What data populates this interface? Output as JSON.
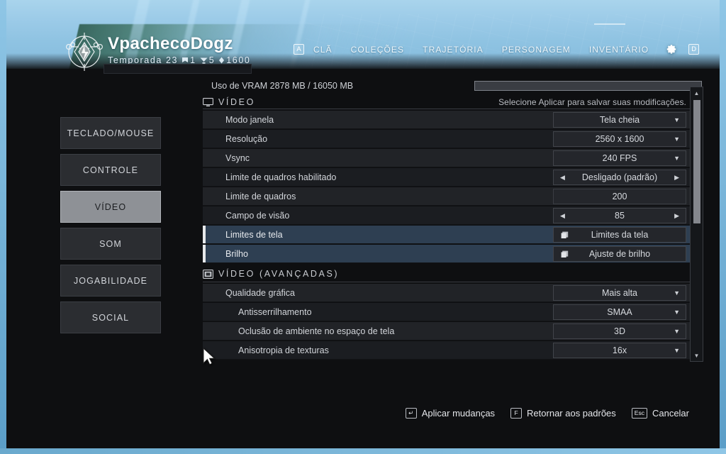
{
  "header": {
    "player_name": "VpachecoDogz",
    "season_label": "Temporada 23",
    "stats": [
      {
        "icon": "banner-icon",
        "value": "1"
      },
      {
        "icon": "crest-icon",
        "value": "5"
      },
      {
        "icon": "power-icon",
        "value": "1600"
      }
    ],
    "nav": {
      "left_key": "A",
      "right_key": "D",
      "items": [
        {
          "label": "CLÃ",
          "name": "nav-item-cla"
        },
        {
          "label": "COLEÇÕES",
          "name": "nav-item-colecoes"
        },
        {
          "label": "TRAJETÓRIA",
          "name": "nav-item-trajetoria"
        },
        {
          "label": "PERSONAGEM",
          "name": "nav-item-personagem"
        },
        {
          "label": "INVENTÁRIO",
          "name": "nav-item-inventario"
        }
      ],
      "settings_icon": "gear-icon"
    }
  },
  "sidebar": {
    "items": [
      {
        "label": "TECLADO/MOUSE",
        "name": "sidebar-item-teclado-mouse",
        "active": false
      },
      {
        "label": "CONTROLE",
        "name": "sidebar-item-controle",
        "active": false
      },
      {
        "label": "VÍDEO",
        "name": "sidebar-item-video",
        "active": true
      },
      {
        "label": "SOM",
        "name": "sidebar-item-som",
        "active": false
      },
      {
        "label": "JOGABILIDADE",
        "name": "sidebar-item-jogabilidade",
        "active": false
      },
      {
        "label": "SOCIAL",
        "name": "sidebar-item-social",
        "active": false
      }
    ]
  },
  "vram": {
    "label": "Uso de VRAM 2878 MB / 16050 MB",
    "used_mb": 2878,
    "total_mb": 16050,
    "percent": 17.9
  },
  "sections": {
    "video": {
      "title": "VÍDEO",
      "icon": "monitor-icon",
      "hint": "Selecione Aplicar para salvar suas modificações.",
      "rows": [
        {
          "label": "Modo janela",
          "value": "Tela cheia",
          "control": "dropdown",
          "highlighted": false
        },
        {
          "label": "Resolução",
          "value": "2560 x 1600",
          "control": "dropdown",
          "highlighted": false
        },
        {
          "label": "Vsync",
          "value": "240 FPS",
          "control": "dropdown",
          "highlighted": false
        },
        {
          "label": "Limite de quadros habilitado",
          "value": "Desligado (padrão)",
          "control": "stepper",
          "highlighted": false
        },
        {
          "label": "Limite de quadros",
          "value": "200",
          "control": "value",
          "highlighted": false
        },
        {
          "label": "Campo de visão",
          "value": "85",
          "control": "stepper",
          "highlighted": false
        },
        {
          "label": "Limites de tela",
          "value": "Limites da tela",
          "control": "window",
          "highlighted": true
        },
        {
          "label": "Brilho",
          "value": "Ajuste de brilho",
          "control": "window",
          "highlighted": true
        }
      ]
    },
    "video_advanced": {
      "title": "VÍDEO (AVANÇADAS)",
      "icon": "sliders-icon",
      "rows": [
        {
          "label": "Qualidade gráfica",
          "value": "Mais alta",
          "control": "dropdown",
          "indent": false
        },
        {
          "label": "Antisserrilhamento",
          "value": "SMAA",
          "control": "dropdown",
          "indent": true
        },
        {
          "label": "Oclusão de ambiente no espaço de tela",
          "value": "3D",
          "control": "dropdown",
          "indent": true
        },
        {
          "label": "Anisotropia de texturas",
          "value": "16x",
          "control": "dropdown",
          "indent": true
        }
      ]
    }
  },
  "scrollbar": {
    "up_icon": "chevron-up-icon",
    "down_icon": "chevron-down-icon"
  },
  "bottom_bar": {
    "actions": [
      {
        "key": "↵",
        "label": "Aplicar mudanças",
        "name": "apply-changes-button"
      },
      {
        "key": "F",
        "label": "Retornar aos padrões",
        "name": "restore-defaults-button"
      },
      {
        "key": "Esc",
        "label": "Cancelar",
        "name": "cancel-button"
      }
    ]
  },
  "colors": {
    "accent_blue": "#8fc6e6",
    "row_highlight": "#2e3f52",
    "panel_bg": "#212327",
    "text": "#d2d5da"
  }
}
